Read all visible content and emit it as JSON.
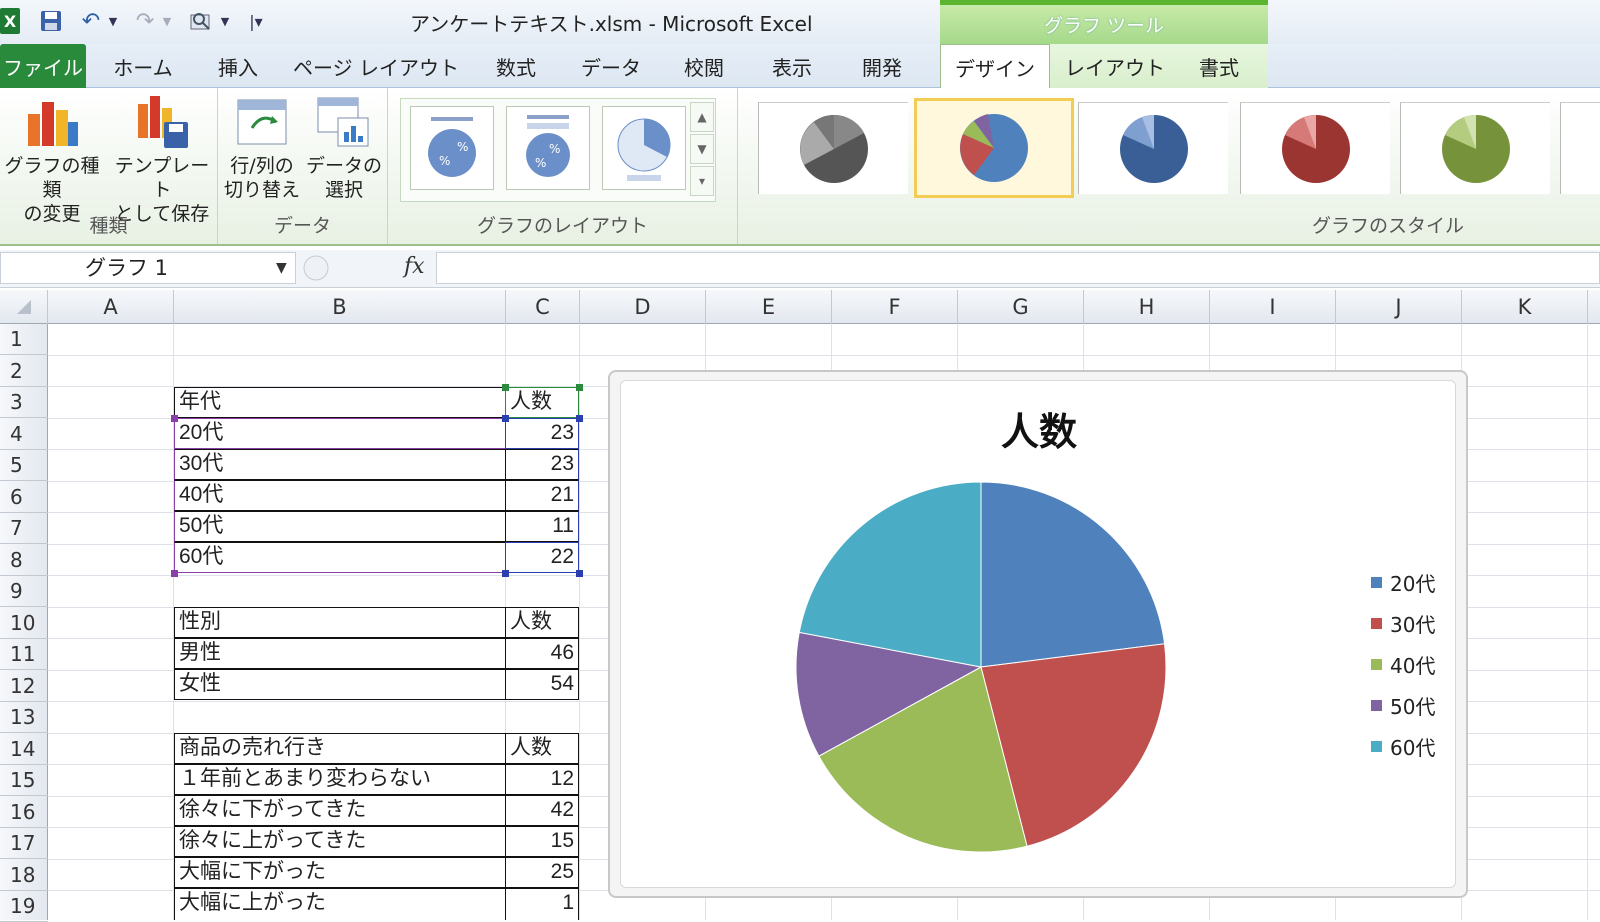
{
  "window": {
    "title": "アンケートテキスト.xlsm  -  Microsoft Excel",
    "context_tab_group": "グラフ ツール"
  },
  "ribbon_tabs": [
    "ファイル",
    "ホーム",
    "挿入",
    "ページ レイアウト",
    "数式",
    "データ",
    "校閲",
    "表示",
    "開発",
    "デザイン",
    "レイアウト",
    "書式"
  ],
  "ribbon": {
    "group_type": {
      "label": "種類",
      "change_type": "グラフの種類\nの変更",
      "save_template": "テンプレート\nとして保存"
    },
    "group_data": {
      "label": "データ",
      "switch_row_col": "行/列の\n切り替え",
      "select_data": "データの\n選択"
    },
    "group_layout": {
      "label": "グラフのレイアウト"
    },
    "group_styles": {
      "label": "グラフのスタイル"
    }
  },
  "formula_bar": {
    "name_box": "グラフ 1",
    "fx": "fx",
    "formula": ""
  },
  "columns": [
    "A",
    "B",
    "C",
    "D",
    "E",
    "F",
    "G",
    "H",
    "I",
    "J",
    "K"
  ],
  "rows": [
    "1",
    "2",
    "3",
    "4",
    "5",
    "6",
    "7",
    "8",
    "9",
    "10",
    "11",
    "12",
    "13",
    "14",
    "15",
    "16",
    "17",
    "18",
    "19"
  ],
  "tables": [
    {
      "header": [
        "年代",
        "人数"
      ],
      "rows": [
        [
          "20代",
          "23"
        ],
        [
          "30代",
          "23"
        ],
        [
          "40代",
          "21"
        ],
        [
          "50代",
          "11"
        ],
        [
          "60代",
          "22"
        ]
      ]
    },
    {
      "header": [
        "性別",
        "人数"
      ],
      "rows": [
        [
          "男性",
          "46"
        ],
        [
          "女性",
          "54"
        ]
      ]
    },
    {
      "header": [
        "商品の売れ行き",
        "人数"
      ],
      "rows": [
        [
          "１年前とあまり変わらない",
          "12"
        ],
        [
          "徐々に下がってきた",
          "42"
        ],
        [
          "徐々に上がってきた",
          "15"
        ],
        [
          "大幅に下がった",
          "25"
        ],
        [
          "大幅に上がった",
          "1"
        ]
      ]
    }
  ],
  "chart_data": {
    "type": "pie",
    "title": "人数",
    "categories": [
      "20代",
      "30代",
      "40代",
      "50代",
      "60代"
    ],
    "values": [
      23,
      23,
      21,
      11,
      22
    ],
    "colors": [
      "#4f81bd",
      "#c0504d",
      "#9bbb59",
      "#8064a2",
      "#4bacc6"
    ],
    "legend": "right"
  }
}
